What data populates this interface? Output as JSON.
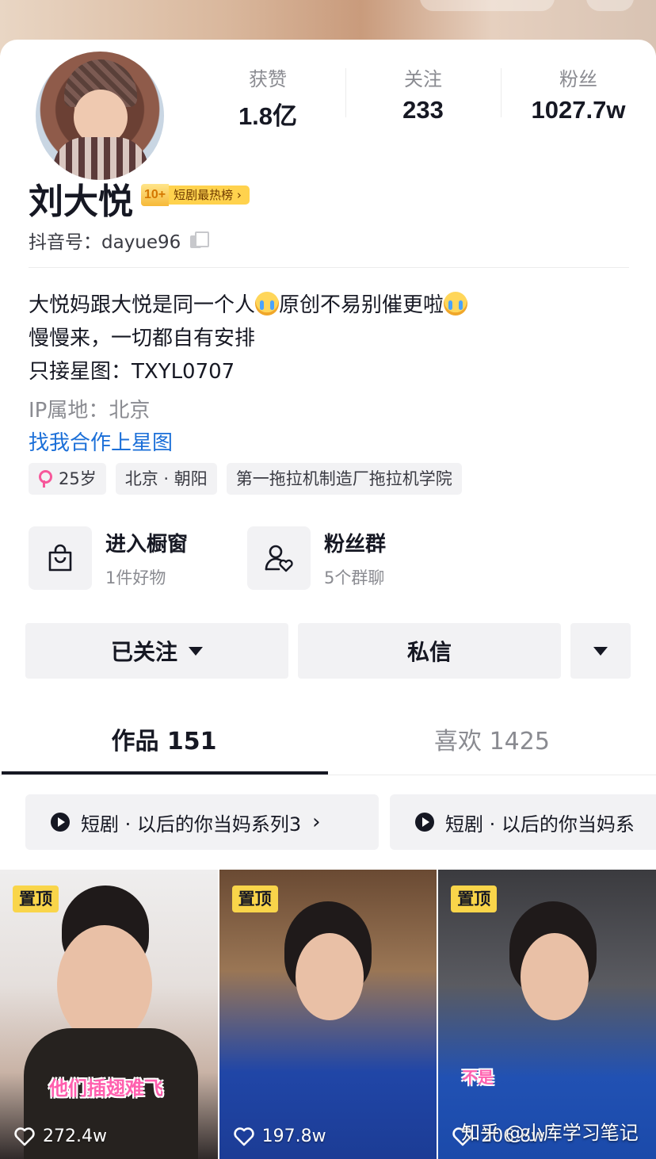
{
  "profile": {
    "name": "刘大悦",
    "rank_badge": {
      "number": "10+",
      "text": "短剧最热榜 ›"
    },
    "douyin_id": "抖音号：dayue96",
    "stats": [
      {
        "label": "获赞",
        "value": "1.8亿"
      },
      {
        "label": "关注",
        "value": "233"
      },
      {
        "label": "粉丝",
        "value": "1027.7w"
      }
    ],
    "bio_lines": [
      "大悦妈跟大悦是同一个人",
      "原创不易别催更啦",
      "慢慢来，一切都自有安排",
      "只接星图：TXYL0707"
    ],
    "ip_location": "IP属地：北京",
    "star_link": "找我合作上星图",
    "tags": [
      "25岁",
      "北京 · 朝阳",
      "第一拖拉机制造厂拖拉机学院"
    ]
  },
  "features": {
    "shop": {
      "title": "进入橱窗",
      "subtitle": "1件好物",
      "icon": "shopping-bag-icon"
    },
    "fans_group": {
      "title": "粉丝群",
      "subtitle": "5个群聊",
      "icon": "user-heart-icon"
    }
  },
  "actions": {
    "follow_label": "已关注",
    "message_label": "私信"
  },
  "tabs": [
    {
      "label": "作品 151",
      "active": true
    },
    {
      "label": "喜欢 1425",
      "active": false
    }
  ],
  "series": [
    {
      "label": "短剧 · 以后的你当妈系列3"
    },
    {
      "label": "短剧 · 以后的你当妈系"
    }
  ],
  "videos": [
    {
      "pin": "置顶",
      "likes": "272.4w",
      "caption": "他们插翅难飞"
    },
    {
      "pin": "置顶",
      "likes": "197.8w",
      "caption": ""
    },
    {
      "pin": "置顶",
      "likes": "206.8w",
      "caption": "不是"
    }
  ],
  "watermark": "知乎 @小库学习笔记",
  "colors": {
    "link": "#1b6fd8",
    "badge": "#ffd24d",
    "pin": "#f9d54a",
    "subtitle": "#ff5fae"
  }
}
